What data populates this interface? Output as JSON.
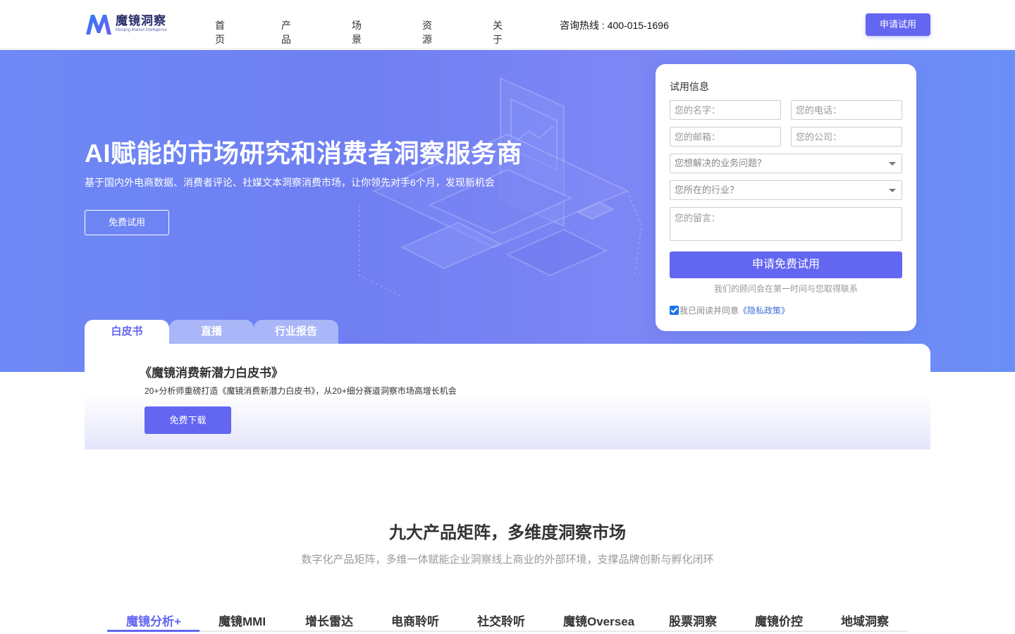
{
  "header": {
    "logo_name": "魔镜洞察",
    "logo_sub": "Moojing Market Intelligence",
    "nav": [
      "首页",
      "产品",
      "场景",
      "资源",
      "关于"
    ],
    "hotline": "咨询热线 : 400-015-1696",
    "apply_label": "申请试用"
  },
  "hero": {
    "title": "AI赋能的市场研究和消费者洞察服务商",
    "subtitle": "基于国内外电商数据、消费者评论、社媒文本洞察消费市场，让你领先对手6个月，发现新机会",
    "button": "免费试用"
  },
  "form": {
    "title": "试用信息",
    "name_placeholder": "您的名字：",
    "phone_placeholder": "您的电话：",
    "email_placeholder": "您的邮箱：",
    "company_placeholder": "您的公司：",
    "question_select": "您想解决的业务问题？",
    "industry_select": "您所在的行业？",
    "message_placeholder": "您的留言：",
    "submit": "申请免费试用",
    "note": "我们的顾问会在第一时间与您取得联系",
    "agree_text": "我已阅读并同意",
    "policy_link": "《隐私政策》"
  },
  "tabs": [
    "白皮书",
    "直播",
    "行业报告"
  ],
  "panel": {
    "title": "《魔镜消费新潜力白皮书》",
    "desc": "20+分析师重磅打造《魔镜消费新潜力白皮书》，从20+细分赛道洞察市场高增长机会",
    "button": "免费下载"
  },
  "products": {
    "title": "九大产品矩阵，多维度洞察市场",
    "subtitle": "数字化产品矩阵，多维一体赋能企业洞察线上商业的外部环境，支撑品牌创新与孵化闭环",
    "tabs": [
      "魔镜分析+",
      "魔镜MMI",
      "增长雷达",
      "电商聆听",
      "社交聆听",
      "魔镜Oversea",
      "股票洞察",
      "魔镜价控",
      "地域洞察"
    ]
  },
  "colors": {
    "accent": "#6366f1",
    "hero_bg": "#7083f4",
    "tab_inactive": "#a9b6f8"
  }
}
